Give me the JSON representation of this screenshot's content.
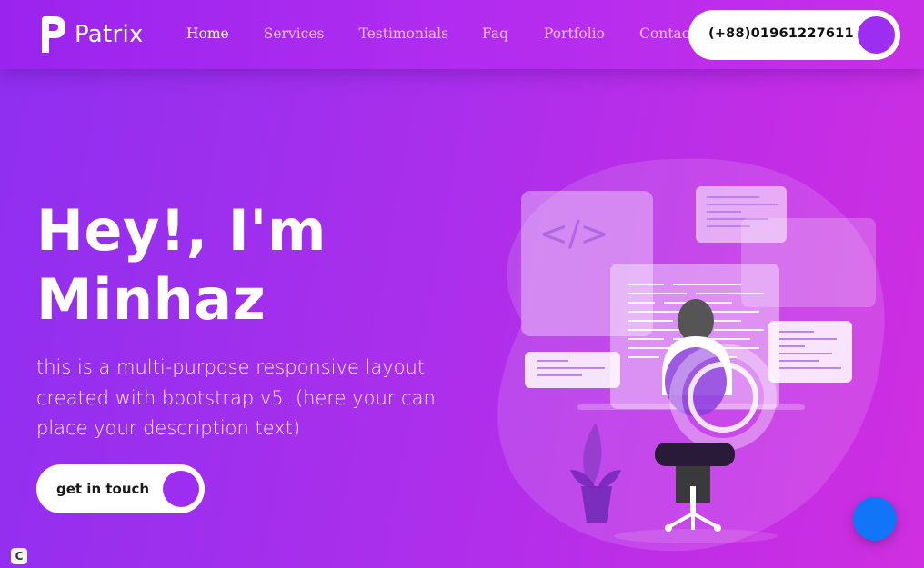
{
  "brand": {
    "name": "Patrix",
    "logo_icon": "letter-p-logo-icon"
  },
  "nav": {
    "items": [
      {
        "label": "Home",
        "active": true
      },
      {
        "label": "Services",
        "active": false
      },
      {
        "label": "Testimonials",
        "active": false
      },
      {
        "label": "Faq",
        "active": false
      },
      {
        "label": "Portfolio",
        "active": false
      },
      {
        "label": "Contact",
        "active": false
      }
    ]
  },
  "phone": {
    "number": "(+88)01961227611"
  },
  "hero": {
    "title_line1": "Hey!, I'm",
    "title_line2": "Minhaz",
    "description_line1": "this is a multi-purpose responsive layout",
    "description_line2": "created with bootstrap v5. (here your can",
    "description_line3": "place your description text)",
    "cta_label": "get in touch",
    "illustration_icon": "developer-at-desk-illustration",
    "code_symbol": "</>"
  },
  "chat": {
    "icon": "chat-bubble-icon"
  },
  "badge": {
    "label": "C"
  },
  "colors": {
    "accent": "#9d2df0",
    "gradient_start": "#8f2ff0",
    "gradient_end": "#cf2fe0",
    "chat_button": "#1274f6"
  }
}
